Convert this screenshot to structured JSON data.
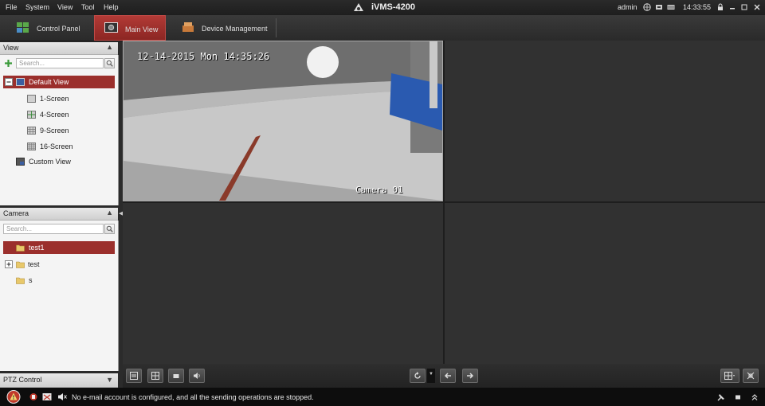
{
  "menu": {
    "items": [
      "File",
      "System",
      "View",
      "Tool",
      "Help"
    ],
    "app_title": "iVMS-4200",
    "user": "admin",
    "clock": "14:33:55"
  },
  "tabs": [
    {
      "label": "Control Panel"
    },
    {
      "label": "Main View"
    },
    {
      "label": "Device Management"
    }
  ],
  "view_panel": {
    "title": "View",
    "search_placeholder": "Search...",
    "items": [
      {
        "label": "Default View"
      },
      {
        "label": "1-Screen"
      },
      {
        "label": "4-Screen"
      },
      {
        "label": "9-Screen"
      },
      {
        "label": "16-Screen"
      },
      {
        "label": "Custom View"
      }
    ]
  },
  "camera_panel": {
    "title": "Camera",
    "search_placeholder": "Search...",
    "items": [
      {
        "label": "test1"
      },
      {
        "label": "test"
      },
      {
        "label": "s"
      }
    ]
  },
  "ptz_panel": {
    "title": "PTZ Control"
  },
  "video": {
    "osd_datetime": "12-14-2015 Mon 14:35:26",
    "osd_camera": "Camera 01"
  },
  "status": {
    "message": "No e-mail account is configured, and all the sending operations are stopped."
  },
  "colors": {
    "accent_red": "#9b2f2c",
    "background": "#2b2b2b"
  }
}
